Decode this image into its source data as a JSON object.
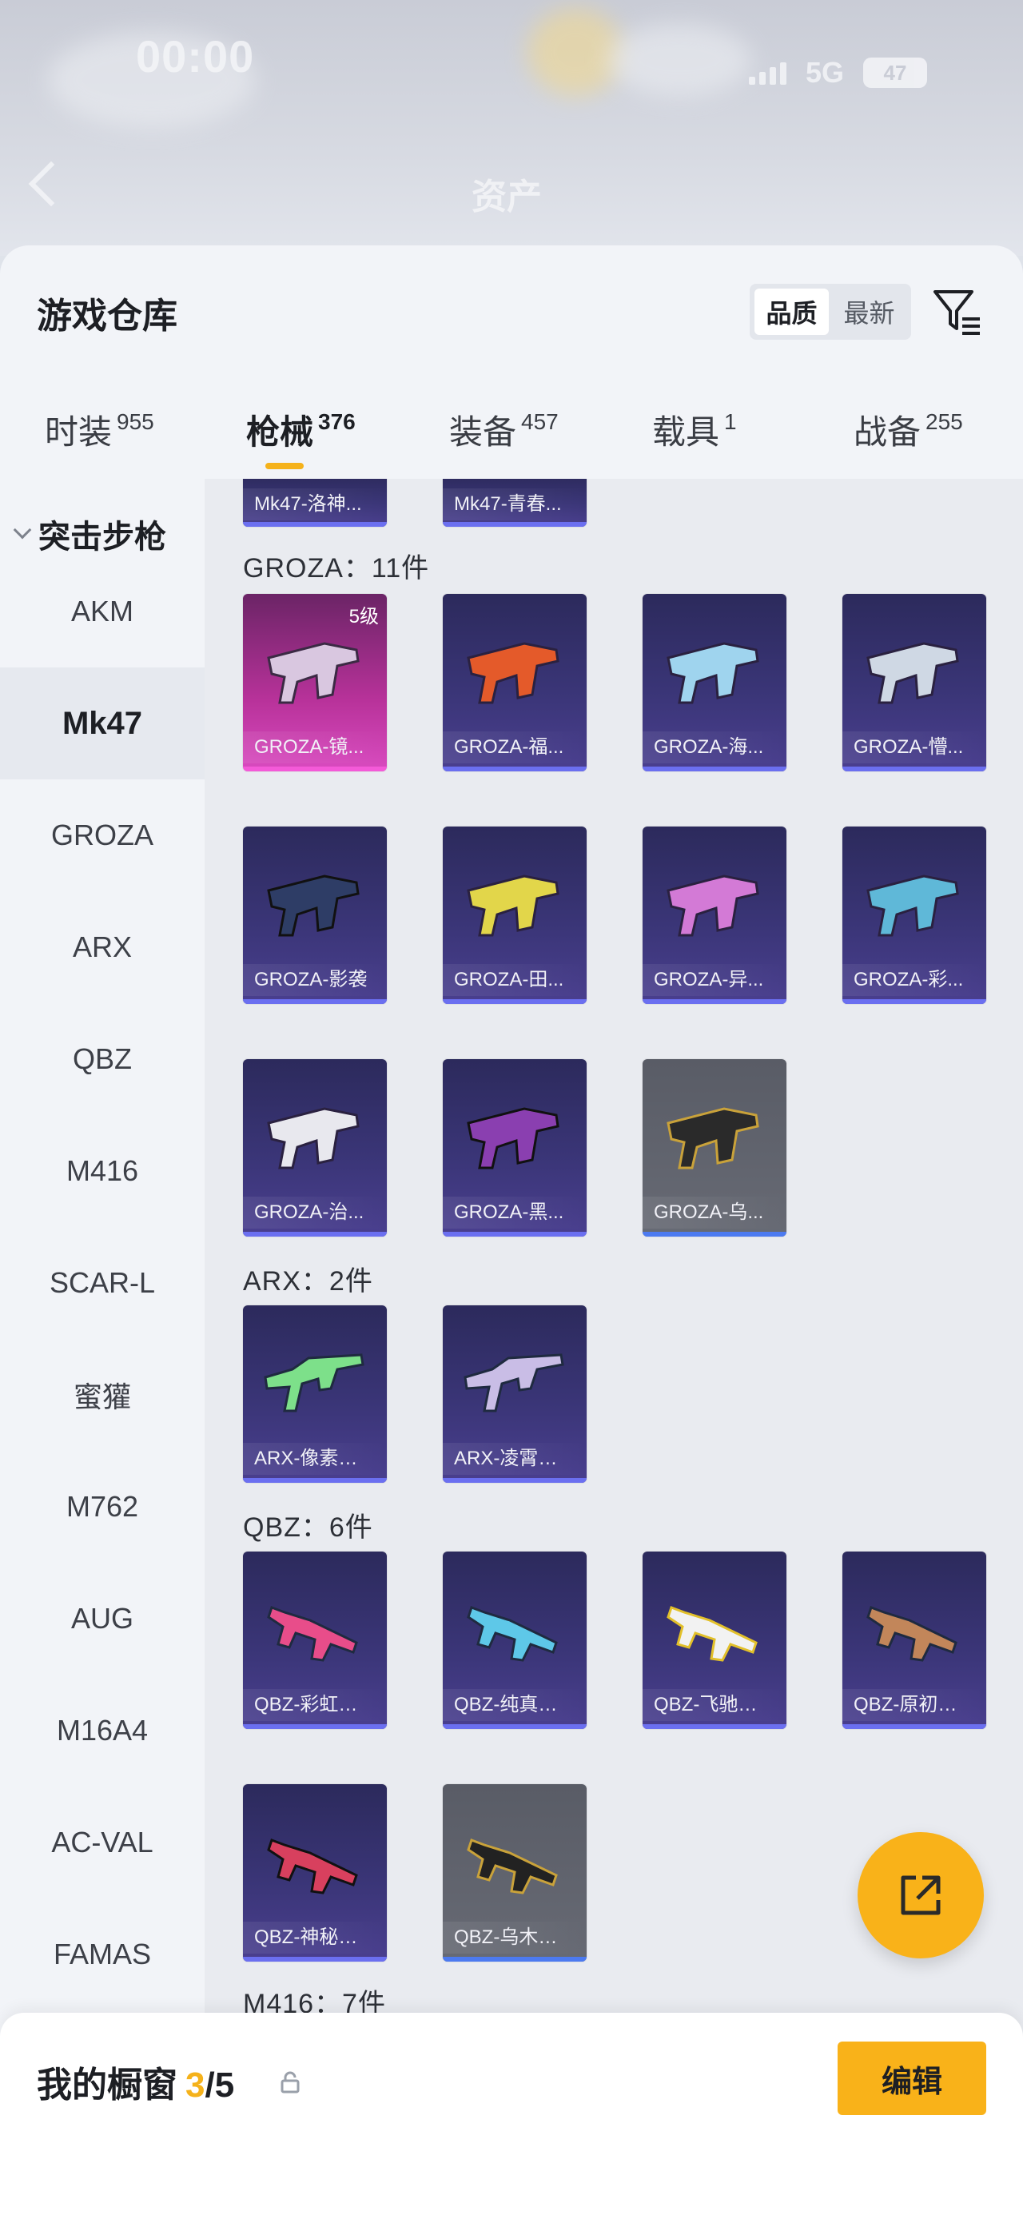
{
  "status_bar": {
    "time": "00:00",
    "network": "5G",
    "battery": "47"
  },
  "background_header": {
    "title": "资产"
  },
  "panel": {
    "title": "游戏仓库",
    "sort_options": [
      "品质",
      "最新"
    ],
    "sort_selected": "品质",
    "filter_icon": "filter-funnel-icon"
  },
  "tabs": [
    {
      "label": "时装",
      "count": "955"
    },
    {
      "label": "枪械",
      "count": "376",
      "active": true
    },
    {
      "label": "装备",
      "count": "457"
    },
    {
      "label": "载具",
      "count": "1"
    },
    {
      "label": "战备",
      "count": "255"
    }
  ],
  "sidebar": {
    "category": "突击步枪",
    "items": [
      "AKM",
      "Mk47",
      "GROZA",
      "ARX",
      "QBZ",
      "M416",
      "SCAR-L",
      "蜜獾",
      "M762",
      "AUG",
      "M16A4",
      "AC-VAL",
      "FAMAS"
    ],
    "active": "Mk47"
  },
  "content": {
    "top_partial": [
      {
        "name": "Mk47-洛神..."
      },
      {
        "name": "Mk47-青春..."
      }
    ],
    "groups": [
      {
        "label": "GROZA：11件",
        "items": [
          {
            "name": "GROZA-镜...",
            "level": "5级",
            "rarity": "pink"
          },
          {
            "name": "GROZA-福...",
            "rarity": "purple"
          },
          {
            "name": "GROZA-海...",
            "rarity": "purple"
          },
          {
            "name": "GROZA-懵...",
            "rarity": "purple"
          },
          {
            "name": "GROZA-影袭",
            "rarity": "purple"
          },
          {
            "name": "GROZA-田...",
            "rarity": "purple"
          },
          {
            "name": "GROZA-异...",
            "rarity": "purple"
          },
          {
            "name": "GROZA-彩...",
            "rarity": "purple"
          },
          {
            "name": "GROZA-治...",
            "rarity": "purple"
          },
          {
            "name": "GROZA-黑...",
            "rarity": "purple"
          },
          {
            "name": "GROZA-乌...",
            "rarity": "gray"
          }
        ]
      },
      {
        "label": "ARX：2件",
        "items": [
          {
            "name": "ARX-像素花束",
            "rarity": "purple"
          },
          {
            "name": "ARX-凌霄紫焰",
            "rarity": "purple"
          }
        ]
      },
      {
        "label": "QBZ：6件",
        "items": [
          {
            "name": "QBZ-彩虹符号",
            "rarity": "purple"
          },
          {
            "name": "QBZ-纯真浪花",
            "rarity": "purple"
          },
          {
            "name": "QBZ-飞驰魅影",
            "rarity": "purple"
          },
          {
            "name": "QBZ-原初圣火",
            "rarity": "purple"
          },
          {
            "name": "QBZ-神秘黑猫",
            "rarity": "purple"
          },
          {
            "name": "QBZ-乌木金纹",
            "rarity": "gray"
          }
        ]
      },
      {
        "label": "M416：7件",
        "items": []
      }
    ]
  },
  "share_button": {
    "icon": "share-export-icon"
  },
  "showcase": {
    "title": "我的橱窗",
    "current": "3",
    "total": "/5",
    "lock_icon": "lock-icon",
    "edit_label": "编辑"
  },
  "colors": {
    "accent": "#f9b219",
    "card_purple": "#3a3577",
    "card_pink": "#b8329a",
    "card_gray": "#676a74"
  }
}
